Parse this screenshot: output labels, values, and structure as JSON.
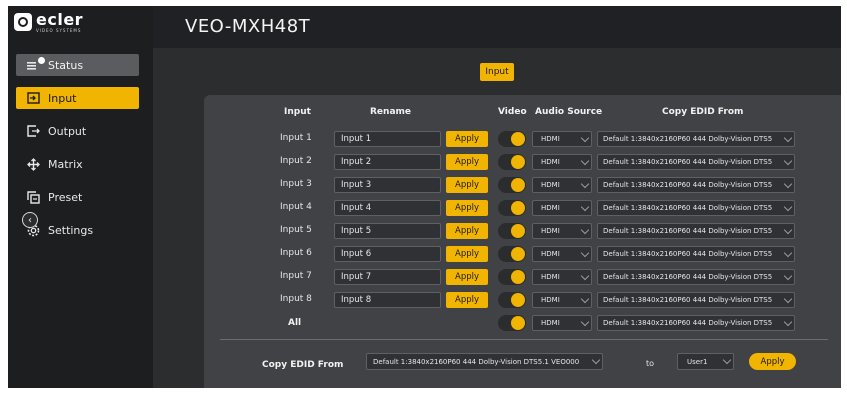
{
  "brand": {
    "logo_word": "ecler",
    "logo_sub": "VIDEO SYSTEMS"
  },
  "header": {
    "device_title": "VEO-MXH48T"
  },
  "sidebar": {
    "items": [
      {
        "label": "Status",
        "icon": "status-icon"
      },
      {
        "label": "Input",
        "icon": "input-icon"
      },
      {
        "label": "Output",
        "icon": "output-icon"
      },
      {
        "label": "Matrix",
        "icon": "matrix-icon"
      },
      {
        "label": "Preset",
        "icon": "preset-icon"
      },
      {
        "label": "Settings",
        "icon": "settings-icon"
      }
    ]
  },
  "main": {
    "section_chip": "Input",
    "table": {
      "headers": {
        "input": "Input",
        "rename": "Rename",
        "video": "Video",
        "audio_source": "Audio Source",
        "copy_edid": "Copy EDID From"
      },
      "rows": [
        {
          "label": "Input 1",
          "rename": "Input 1",
          "apply": "Apply",
          "video_on": true,
          "audio": "HDMI",
          "edid": "Default 1:3840x2160P60 444 Dolby-Vision DTS5"
        },
        {
          "label": "Input 2",
          "rename": "Input 2",
          "apply": "Apply",
          "video_on": true,
          "audio": "HDMI",
          "edid": "Default 1:3840x2160P60 444 Dolby-Vision DTS5"
        },
        {
          "label": "Input 3",
          "rename": "Input 3",
          "apply": "Apply",
          "video_on": true,
          "audio": "HDMI",
          "edid": "Default 1:3840x2160P60 444 Dolby-Vision DTS5"
        },
        {
          "label": "Input 4",
          "rename": "Input 4",
          "apply": "Apply",
          "video_on": true,
          "audio": "HDMI",
          "edid": "Default 1:3840x2160P60 444 Dolby-Vision DTS5"
        },
        {
          "label": "Input 5",
          "rename": "Input 5",
          "apply": "Apply",
          "video_on": true,
          "audio": "HDMI",
          "edid": "Default 1:3840x2160P60 444 Dolby-Vision DTS5"
        },
        {
          "label": "Input 6",
          "rename": "Input 6",
          "apply": "Apply",
          "video_on": true,
          "audio": "HDMI",
          "edid": "Default 1:3840x2160P60 444 Dolby-Vision DTS5"
        },
        {
          "label": "Input 7",
          "rename": "Input 7",
          "apply": "Apply",
          "video_on": true,
          "audio": "HDMI",
          "edid": "Default 1:3840x2160P60 444 Dolby-Vision DTS5"
        },
        {
          "label": "Input 8",
          "rename": "Input 8",
          "apply": "Apply",
          "video_on": true,
          "audio": "HDMI",
          "edid": "Default 1:3840x2160P60 444 Dolby-Vision DTS5"
        }
      ],
      "all_row": {
        "label": "All",
        "video_on": true,
        "audio": "HDMI",
        "edid": "Default 1:3840x2160P60 444 Dolby-Vision DTS5"
      }
    },
    "copy_edid_bottom": {
      "label": "Copy EDID From",
      "source": "Default 1:3840x2160P60 444 Dolby-Vision DTS5.1 VEO000",
      "to_label": "to",
      "target": "User1",
      "apply": "Apply"
    }
  },
  "colors": {
    "accent": "#f1b400",
    "sidebar_bg": "#1d1e20",
    "panel_bg": "#404245",
    "app_bg": "#2b2d2f"
  }
}
